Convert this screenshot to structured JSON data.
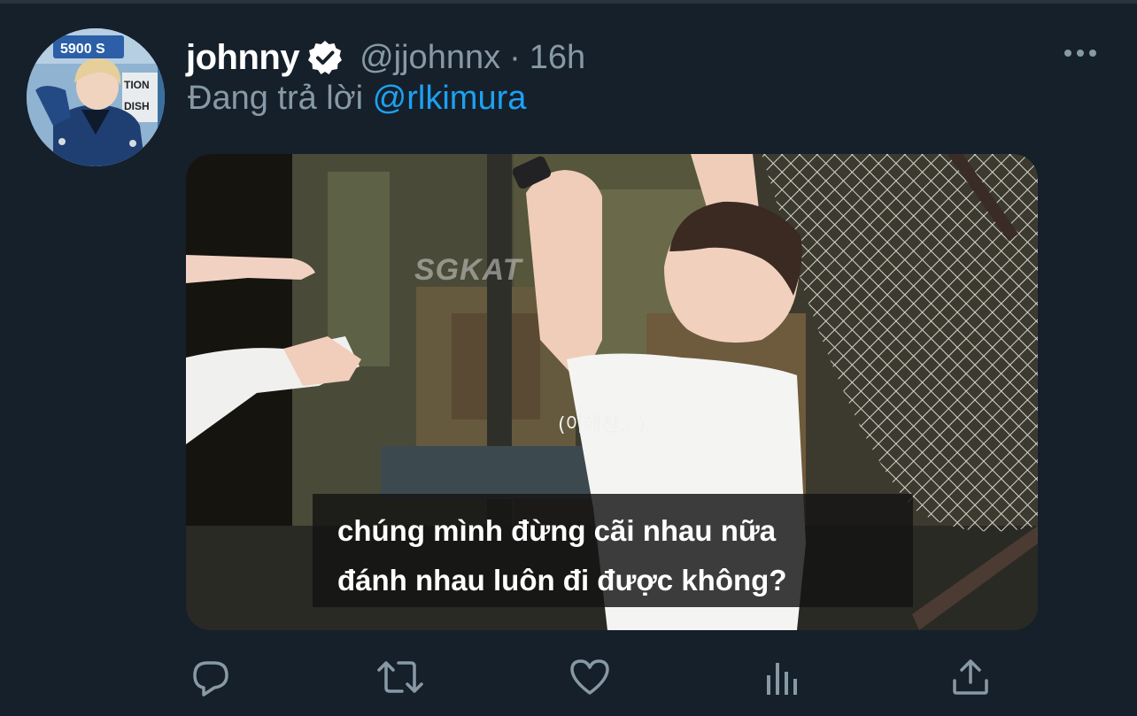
{
  "tweet": {
    "author": {
      "display_name": "johnny",
      "handle": "@jjohnnx",
      "verified_icon": "verified-badge-icon",
      "avatar_sign_text": "5900 S",
      "avatar_sign_text_2": "TION",
      "avatar_sign_text_3": "DISH"
    },
    "separator": "·",
    "time": "16h",
    "reply_prefix": "Đang trả lời ",
    "reply_to": "@rlkimura",
    "media": {
      "watermark": "SGKAT",
      "korean_caption": "(이해찬...)",
      "subtitle_line_1": "chúng mình đừng cãi nhau nữa",
      "subtitle_line_2": "đánh nhau luôn đi được không?"
    },
    "actions": [
      {
        "icon": "reply-icon"
      },
      {
        "icon": "retweet-icon"
      },
      {
        "icon": "like-icon"
      },
      {
        "icon": "analytics-icon"
      },
      {
        "icon": "share-icon"
      }
    ],
    "more_icon": "more-icon"
  },
  "colors": {
    "background": "#15202b",
    "secondary_text": "#8899a6",
    "link": "#1da1f2",
    "primary_text": "#ffffff"
  }
}
